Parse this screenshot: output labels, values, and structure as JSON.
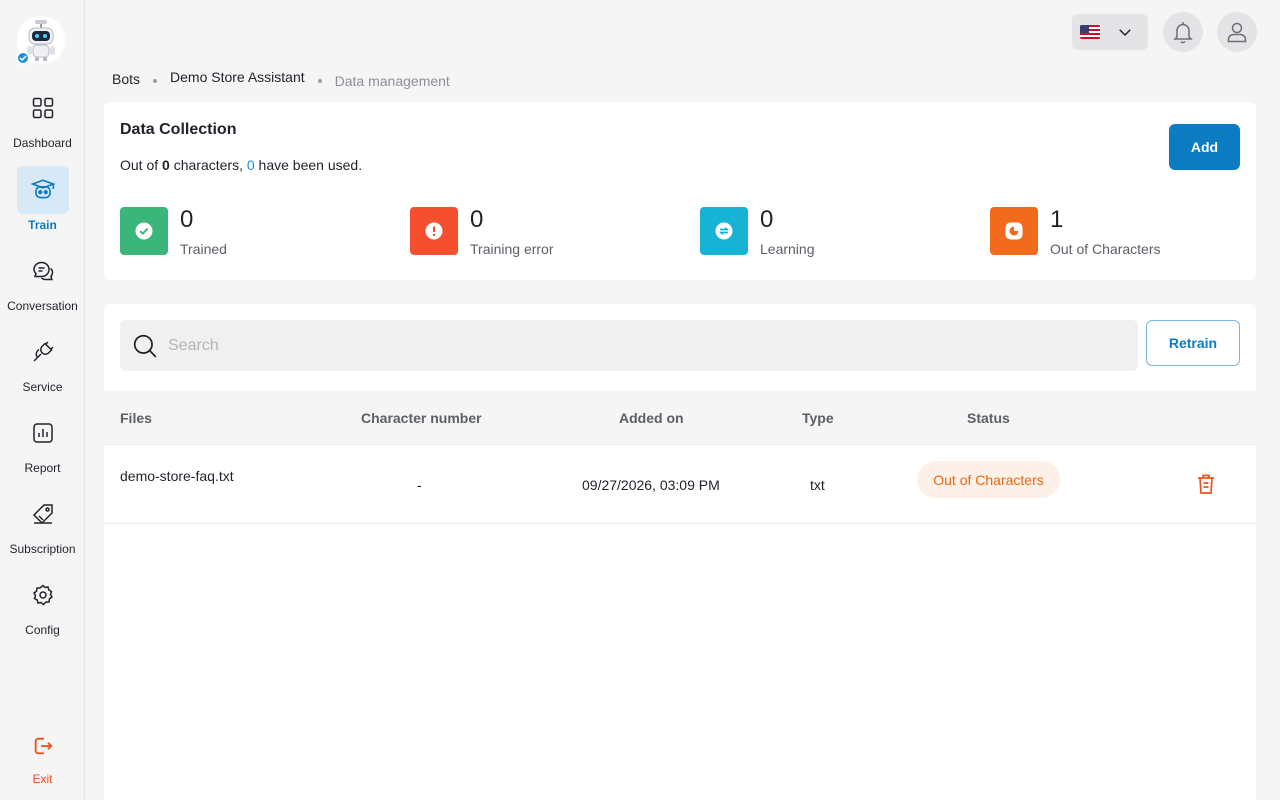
{
  "sidebar": {
    "items": [
      {
        "label": "Dashboard",
        "icon": "dashboard-icon"
      },
      {
        "label": "Train",
        "icon": "train-icon"
      },
      {
        "label": "Conversation",
        "icon": "conversation-icon"
      },
      {
        "label": "Service",
        "icon": "service-icon"
      },
      {
        "label": "Report",
        "icon": "report-icon"
      },
      {
        "label": "Subscription",
        "icon": "subscription-icon"
      },
      {
        "label": "Config",
        "icon": "config-icon"
      }
    ],
    "active": "Train",
    "exit_label": "Exit"
  },
  "topbar": {
    "language_flag": "us-flag-icon",
    "icons": [
      "chevron-down-icon",
      "bell-icon",
      "user-icon"
    ]
  },
  "breadcrumb": {
    "items": [
      "Bots",
      "Demo Store Assistant",
      "Data management"
    ]
  },
  "data_collection": {
    "title": "Data Collection",
    "usage_prefix": "Out of",
    "total_chars": "0",
    "usage_middle": "characters,",
    "used_chars": "0",
    "usage_suffix": "have been used.",
    "add_label": "Add",
    "stats": [
      {
        "value": "0",
        "label": "Trained",
        "color": "#3bb67a",
        "icon": "check-circle-icon"
      },
      {
        "value": "0",
        "label": "Training error",
        "color": "#f4502f",
        "icon": "alert-circle-icon"
      },
      {
        "value": "0",
        "label": "Learning",
        "color": "#17b3d4",
        "icon": "sync-icon"
      },
      {
        "value": "1",
        "label": "Out of Characters",
        "color": "#f26a1b",
        "icon": "pie-chart-icon"
      }
    ]
  },
  "files": {
    "search_placeholder": "Search",
    "retrain_label": "Retrain",
    "columns": [
      "Files",
      "Character number",
      "Added on",
      "Type",
      "Status"
    ],
    "rows": [
      {
        "file": "demo-store-faq.txt",
        "characters": "-",
        "added_on": "09/27/2026, 03:09 PM",
        "type": "txt",
        "status": "Out of Characters"
      }
    ]
  },
  "colors": {
    "primary": "#0b7bc2",
    "danger": "#e8541c",
    "status_warning_bg": "#fdf0e8",
    "status_warning_text": "#e8690e"
  }
}
